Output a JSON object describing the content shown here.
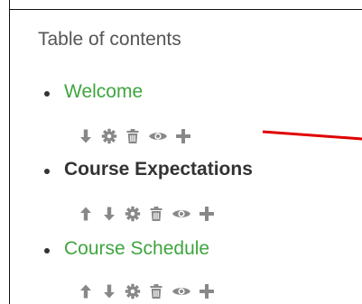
{
  "toc": {
    "heading": "Table of contents",
    "items": [
      {
        "label": "Welcome",
        "state": "link",
        "actions": [
          "move-down",
          "settings",
          "delete",
          "visibility",
          "add"
        ]
      },
      {
        "label": "Course Expectations",
        "state": "current",
        "actions": [
          "move-up",
          "move-down",
          "settings",
          "delete",
          "visibility",
          "add"
        ]
      },
      {
        "label": "Course Schedule",
        "state": "link",
        "actions": [
          "move-up",
          "move-down",
          "settings",
          "delete",
          "visibility",
          "add"
        ]
      }
    ]
  },
  "colors": {
    "link": "#3fa53f",
    "current_text": "#333333",
    "heading_text": "#555555",
    "icon": "#888888",
    "annotation_line": "#e00000",
    "border": "#111111"
  },
  "icons": {
    "move-up": "arrow-up-icon",
    "move-down": "arrow-down-icon",
    "settings": "gear-icon",
    "delete": "trash-icon",
    "visibility": "eye-icon",
    "add": "plus-icon"
  }
}
